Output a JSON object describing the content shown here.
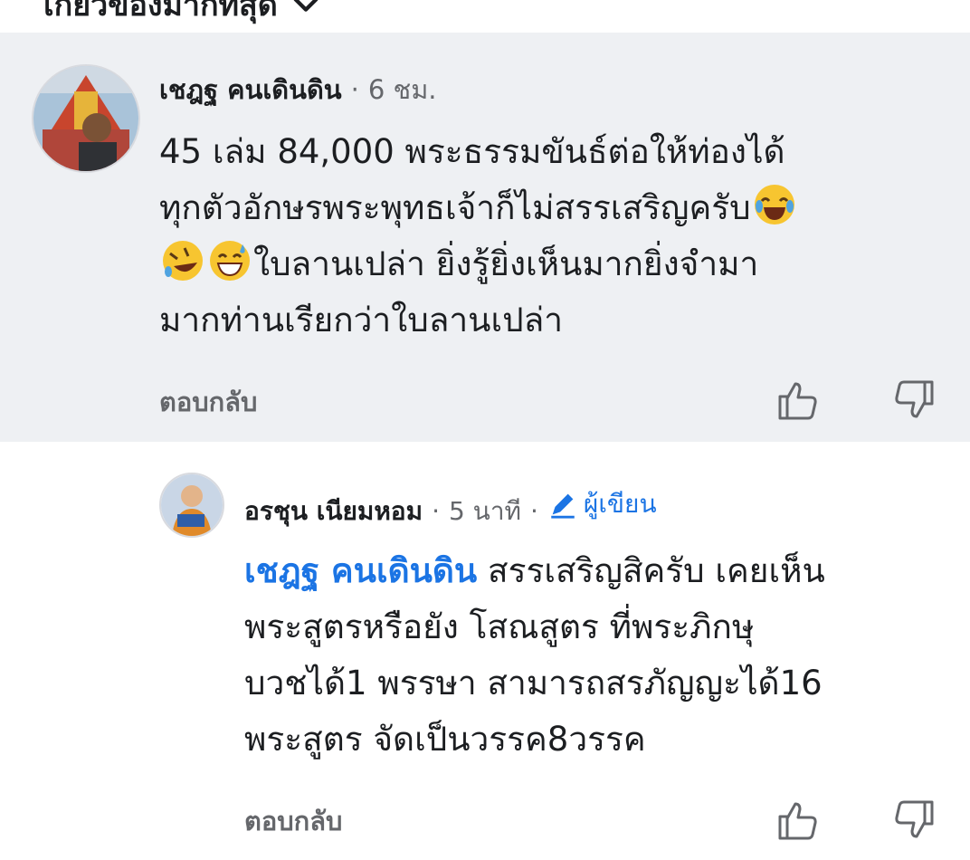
{
  "sort_label": "เกี่ยวข้องมากที่สุด",
  "comments": [
    {
      "author": "เชฎฐ คนเดินดิน",
      "separator": "·",
      "time": "6 ชม.",
      "lines": [
        "45 เล่ม 84,000 พระธรรมขันธ์ต่อให้ท่องได้",
        "ทุกตัวอักษรพระพุทธเจ้าก็ไม่สรรเสริญครับ",
        "ใบลานเปล่า ยิ่งรู้ยิ่งเห็นมากยิ่งจำมา",
        "มากท่านเรียกว่าใบลานเปล่า"
      ],
      "reply_label": "ตอบกลับ"
    },
    {
      "author": "อรชุน เนียมหอม",
      "separator": "·",
      "time": "5 นาที",
      "badge": "ผู้เขียน",
      "mention": "เชฎฐ คนเดินดิน",
      "lines": [
        " สรรเสริญสิครับ เคยเห็น",
        "พระสูตรหรือยัง โสณสูตร ที่พระภิกษุ",
        "บวชได้1 พรรษา สามารถสรภัญญะได้16",
        "พระสูตร จัดเป็นวรรค8วรรค"
      ],
      "reply_label": "ตอบกลับ"
    }
  ],
  "icons": {
    "sort": "chevron-down-icon",
    "like": "thumbs-up-icon",
    "dislike": "thumbs-down-icon",
    "badge": "pencil-icon",
    "emoji_1": "face-with-tears-of-joy",
    "emoji_2": "rolling-on-floor-laughing",
    "emoji_3": "grinning-face-with-sweat"
  },
  "colors": {
    "link": "#1b74e4",
    "secondary_text": "#65676b",
    "highlight_bg": "#eef0f3"
  }
}
